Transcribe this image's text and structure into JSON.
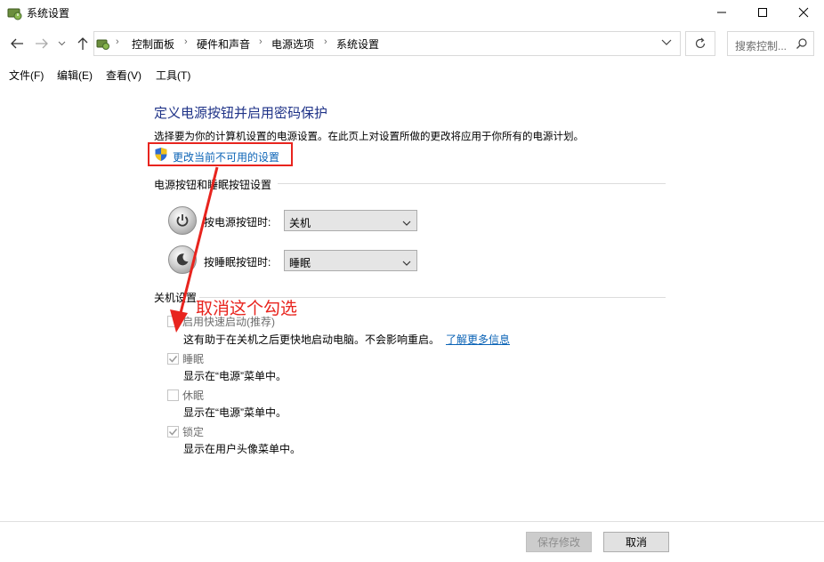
{
  "window": {
    "title": "系统设置"
  },
  "address": {
    "crumbs": [
      "控制面板",
      "硬件和声音",
      "电源选项",
      "系统设置"
    ]
  },
  "search": {
    "placeholder": "搜索控制..."
  },
  "menu": [
    "文件(F)",
    "编辑(E)",
    "查看(V)",
    "工具(T)"
  ],
  "content": {
    "heading": "定义电源按钮并启用密码保护",
    "description": "选择要为你的计算机设置的电源设置。在此页上对设置所做的更改将应用于你所有的电源计划。",
    "change_link": "更改当前不可用的设置"
  },
  "power_group": {
    "title": "电源按钮和睡眠按钮设置",
    "power_button": {
      "label": "按电源按钮时:",
      "value": "关机"
    },
    "sleep_button": {
      "label": "按睡眠按钮时:",
      "value": "睡眠"
    }
  },
  "shutdown_group": {
    "title": "关机设置",
    "items": [
      {
        "label": "启用快速启动(推荐)",
        "checked": false,
        "desc": "这有助于在关机之后更快地启动电脑。不会影响重启。",
        "link": "了解更多信息"
      },
      {
        "label": "睡眠",
        "checked": true,
        "desc": "显示在“电源”菜单中。"
      },
      {
        "label": "休眠",
        "checked": false,
        "desc": "显示在“电源”菜单中。"
      },
      {
        "label": "锁定",
        "checked": true,
        "desc": "显示在用户头像菜单中。"
      }
    ]
  },
  "annotation": {
    "text": "取消这个勾选",
    "color": "#e8241e"
  },
  "footer": {
    "save": "保存修改",
    "cancel": "取消"
  }
}
